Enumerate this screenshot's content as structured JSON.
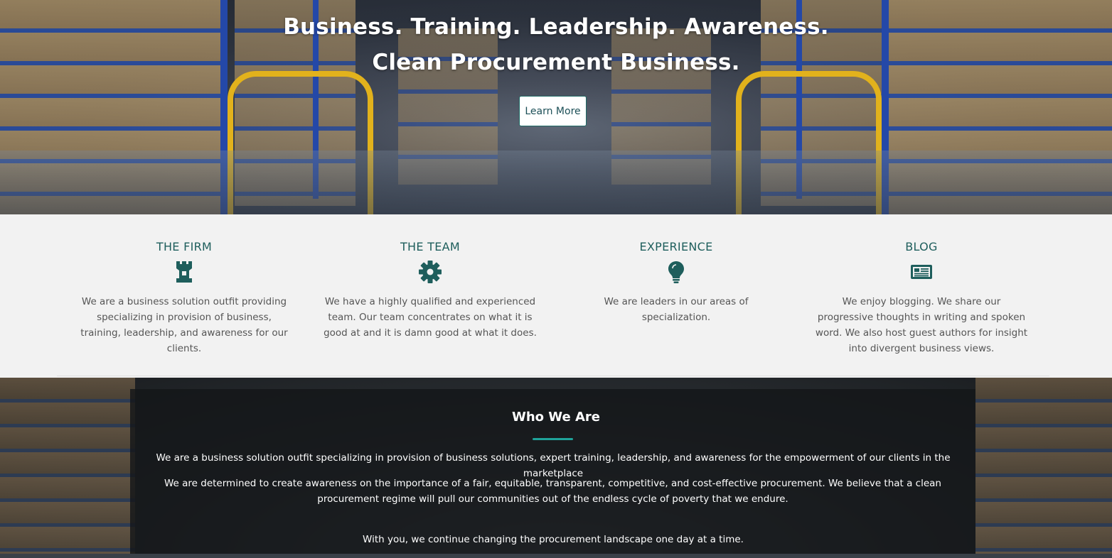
{
  "hero": {
    "title_line1": "Business. Training. Leadership. Awareness.",
    "title_line2": "Clean Procurement Business.",
    "button_label": "Learn More"
  },
  "features": [
    {
      "title": "THE FIRM",
      "icon": "rook-icon",
      "text": "We are a business solution outfit providing specializing in provision of business, training, leadership, and awareness for our clients."
    },
    {
      "title": "THE TEAM",
      "icon": "gear-icon",
      "text": "We have a highly qualified and experienced team. Our team concentrates on what it is good at and it is damn good at what it does."
    },
    {
      "title": "EXPERIENCE",
      "icon": "lightbulb-icon",
      "text": "We are leaders in our areas of specialization."
    },
    {
      "title": "BLOG",
      "icon": "newspaper-icon",
      "text": "We enjoy blogging. We share our progressive thoughts in writing and spoken word. We also host guest authors for insight into divergent business views."
    }
  ],
  "who": {
    "title": "Who We Are",
    "paragraph1": "We are a business solution outfit specializing in provision of business solutions, expert training, leadership, and awareness for the empowerment of our clients in the marketplace",
    "paragraph2": "We are determined to create awareness on the importance of a fair, equitable, transparent, competitive, and cost-effective procurement. We believe that a clean procurement regime will pull our communities out of the endless cycle of poverty that we endure.",
    "paragraph3": "With you, we continue changing the procurement landscape one day at a time."
  },
  "colors": {
    "accent": "#1e5e5c",
    "underline": "#1fa39a",
    "rack_blue": "#2448a8",
    "rail_yellow": "#e2b21c"
  }
}
